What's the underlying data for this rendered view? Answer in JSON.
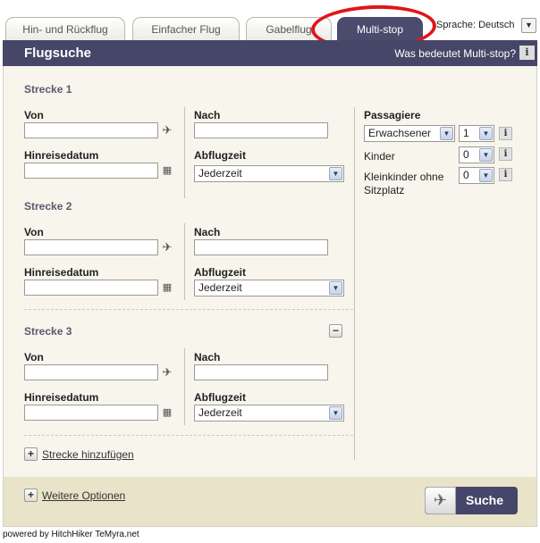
{
  "tabs": [
    {
      "label": "Hin- und Rückflug",
      "active": false
    },
    {
      "label": "Einfacher Flug",
      "active": false
    },
    {
      "label": "Gabelflug",
      "active": false
    },
    {
      "label": "Multi-stop",
      "active": true
    }
  ],
  "language": {
    "label": "Sprache: Deutsch"
  },
  "header": {
    "title": "Flugsuche",
    "help_link": "Was bedeutet Multi-stop?",
    "help_icon": "i"
  },
  "segments": [
    {
      "title": "Strecke 1",
      "from_label": "Von",
      "to_label": "Nach",
      "date_label": "Hinreisedatum",
      "time_label": "Abflugzeit",
      "from_value": "",
      "to_value": "",
      "date_value": "",
      "time_value": "Jederzeit"
    },
    {
      "title": "Strecke 2",
      "from_label": "Von",
      "to_label": "Nach",
      "date_label": "Hinreisedatum",
      "time_label": "Abflugzeit",
      "from_value": "",
      "to_value": "",
      "date_value": "",
      "time_value": "Jederzeit"
    },
    {
      "title": "Strecke 3",
      "from_label": "Von",
      "to_label": "Nach",
      "date_label": "Hinreisedatum",
      "time_label": "Abflugzeit",
      "from_value": "",
      "to_value": "",
      "date_value": "",
      "time_value": "Jederzeit",
      "remove_icon": "−"
    }
  ],
  "add_segment": {
    "icon": "+",
    "label": "Strecke hinzufügen"
  },
  "passengers": {
    "title": "Passagiere",
    "adult_type": "Erwachsener",
    "adult_count": "1",
    "children_label": "Kinder",
    "children_count": "0",
    "infants_label_line1": "Kleinkinder ohne",
    "infants_label_line2": "Sitzplatz",
    "infants_count": "0",
    "info_icon": "i"
  },
  "more_options": {
    "icon": "+",
    "label": "Weitere Optionen"
  },
  "search_button": {
    "label": "Suche"
  },
  "footer_text": "powered by HitchHiker TeMyra.net",
  "colors": {
    "header_bg": "#464668",
    "panel_bg": "#f7f5ec",
    "footer_bg": "#e9e4c9",
    "highlight_circle": "#e0151b"
  }
}
